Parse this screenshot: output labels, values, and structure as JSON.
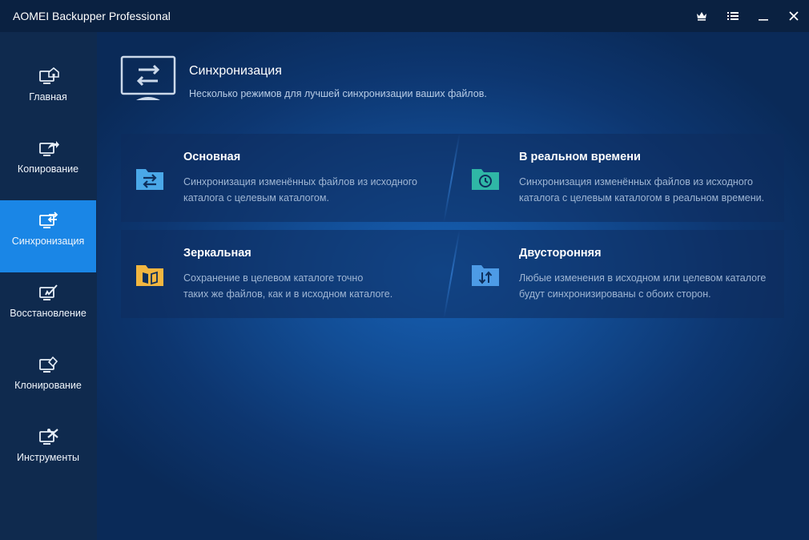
{
  "app": {
    "title": "AOMEI Backupper Professional"
  },
  "titlebar": {
    "icons": [
      "crown-icon",
      "menu-icon",
      "minimize-icon",
      "close-icon"
    ]
  },
  "sidebar": {
    "items": [
      {
        "label": "Главная",
        "icon": "home-icon",
        "active": false
      },
      {
        "label": "Копирование",
        "icon": "backup-icon",
        "active": false
      },
      {
        "label": "Синхронизация",
        "icon": "sync-icon",
        "active": true
      },
      {
        "label": "Восстановление",
        "icon": "restore-icon",
        "active": false
      },
      {
        "label": "Клонирование",
        "icon": "clone-icon",
        "active": false
      },
      {
        "label": "Инструменты",
        "icon": "tools-icon",
        "active": false
      }
    ]
  },
  "header": {
    "title": "Синхронизация",
    "subtitle": "Несколько режимов для лучшей синхронизации ваших файлов."
  },
  "cards": [
    {
      "title": "Основная",
      "desc_line1": "Синхронизация изменённых файлов из исходного",
      "desc_line2": "каталога с целевым каталогом.",
      "icon": "basic-sync-icon",
      "color": "#4aa8e8"
    },
    {
      "title": "В реальном времени",
      "desc_line1": "Синхронизация изменённых файлов из исходного",
      "desc_line2": "каталога с целевым каталогом в реальном времени.",
      "icon": "realtime-sync-icon",
      "color": "#2fb7a6"
    },
    {
      "title": "Зеркальная",
      "desc_line1": "Сохранение в целевом каталоге точно",
      "desc_line2": "таких же файлов, как и в исходном каталоге.",
      "icon": "mirror-sync-icon",
      "color": "#f2b640"
    },
    {
      "title": "Двусторонняя",
      "desc_line1": "Любые изменения в исходном или целевом каталоге",
      "desc_line2": "будут синхронизированы с обоих сторон.",
      "icon": "two-way-sync-icon",
      "color": "#4d9be6"
    }
  ],
  "colors": {
    "accent": "#1a86e6",
    "sidebar": "#0f2a4e",
    "titlebar": "#0a2141"
  }
}
